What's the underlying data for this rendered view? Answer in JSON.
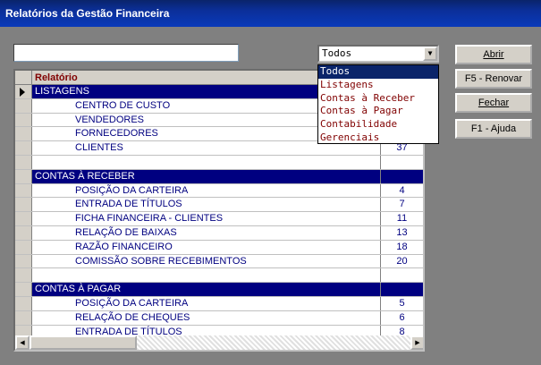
{
  "window": {
    "title": "Relatórios da Gestão Financeira"
  },
  "search": {
    "value": ""
  },
  "filter": {
    "selected": "Todos",
    "options": [
      "Todos",
      "Listagens",
      "Contas à Receber",
      "Contas à Pagar",
      "Contabilidade",
      "Gerenciais"
    ]
  },
  "buttons": {
    "abrir": "Abrir",
    "renovar": "F5 - Renovar",
    "fechar": "Fechar",
    "ajuda": "F1 - Ajuda"
  },
  "grid": {
    "header": "Relatório",
    "rows": [
      {
        "type": "section",
        "name": "LISTAGENS",
        "num": ""
      },
      {
        "type": "item",
        "name": "CENTRO DE CUSTO",
        "num": ""
      },
      {
        "type": "item",
        "name": "VENDEDORES",
        "num": ""
      },
      {
        "type": "item",
        "name": "FORNECEDORES",
        "num": ""
      },
      {
        "type": "item",
        "name": "CLIENTES",
        "num": "37"
      },
      {
        "type": "blank",
        "name": "",
        "num": ""
      },
      {
        "type": "section",
        "name": "CONTAS À RECEBER",
        "num": ""
      },
      {
        "type": "item",
        "name": "POSIÇÃO DA CARTEIRA",
        "num": "4"
      },
      {
        "type": "item",
        "name": "ENTRADA DE TÍTULOS",
        "num": "7"
      },
      {
        "type": "item",
        "name": "FICHA FINANCEIRA - CLIENTES",
        "num": "11"
      },
      {
        "type": "item",
        "name": "RELAÇÃO DE BAIXAS",
        "num": "13"
      },
      {
        "type": "item",
        "name": "RAZÃO FINANCEIRO",
        "num": "18"
      },
      {
        "type": "item",
        "name": "COMISSÃO SOBRE RECEBIMENTOS",
        "num": "20"
      },
      {
        "type": "blank",
        "name": "",
        "num": ""
      },
      {
        "type": "section",
        "name": "CONTAS À PAGAR",
        "num": ""
      },
      {
        "type": "item",
        "name": "POSIÇÃO DA CARTEIRA",
        "num": "5"
      },
      {
        "type": "item",
        "name": "RELAÇÃO DE CHEQUES",
        "num": "6"
      },
      {
        "type": "item",
        "name": "ENTRADA DE TÍTULOS",
        "num": "8"
      }
    ]
  }
}
